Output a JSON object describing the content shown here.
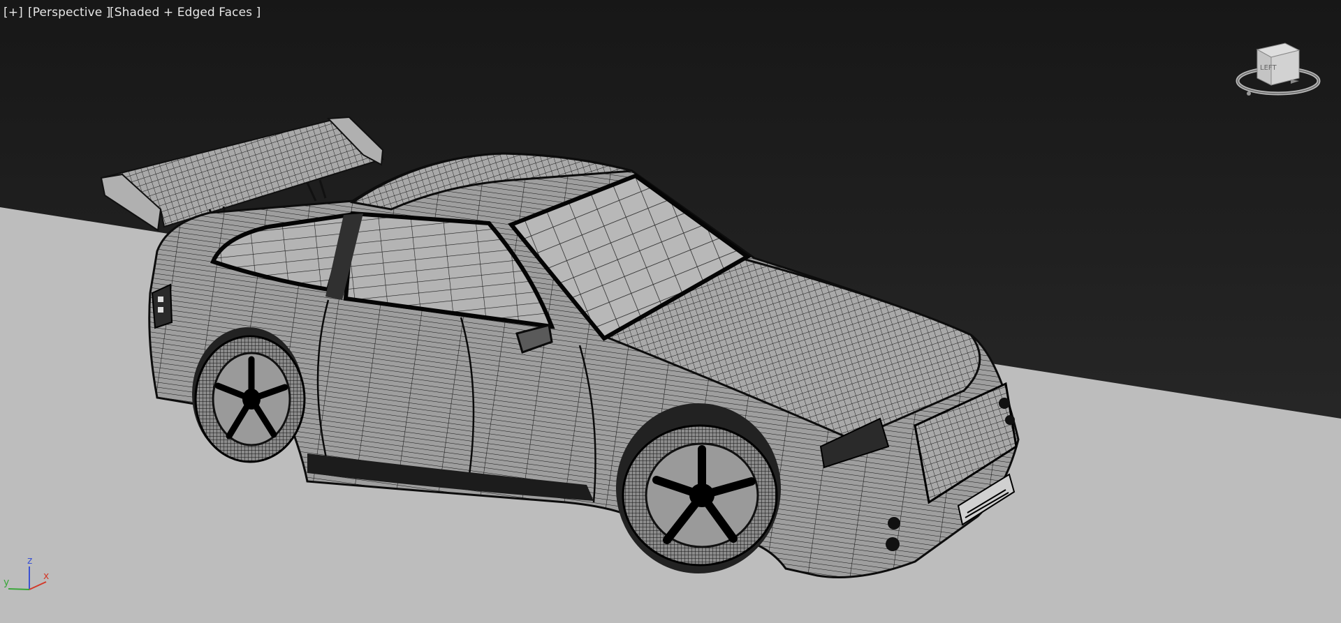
{
  "viewport": {
    "menu_label": "[+]",
    "view_label": "[Perspective ]",
    "shading_label": "[Shaded + Edged Faces ]"
  },
  "viewcube": {
    "face_label": "LEFT",
    "icon": "viewcube-icon"
  },
  "axis_tripod": {
    "x_label": "x",
    "y_label": "y",
    "z_label": "z",
    "x_color": "#d23a2a",
    "y_color": "#3aa63a",
    "z_color": "#3a52d2"
  },
  "colors": {
    "background_top": "#171717",
    "background_bottom": "#2e2e2e",
    "ground": "#bdbdbd",
    "mesh_face": "#a8a8a8",
    "mesh_edge": "#111111"
  }
}
